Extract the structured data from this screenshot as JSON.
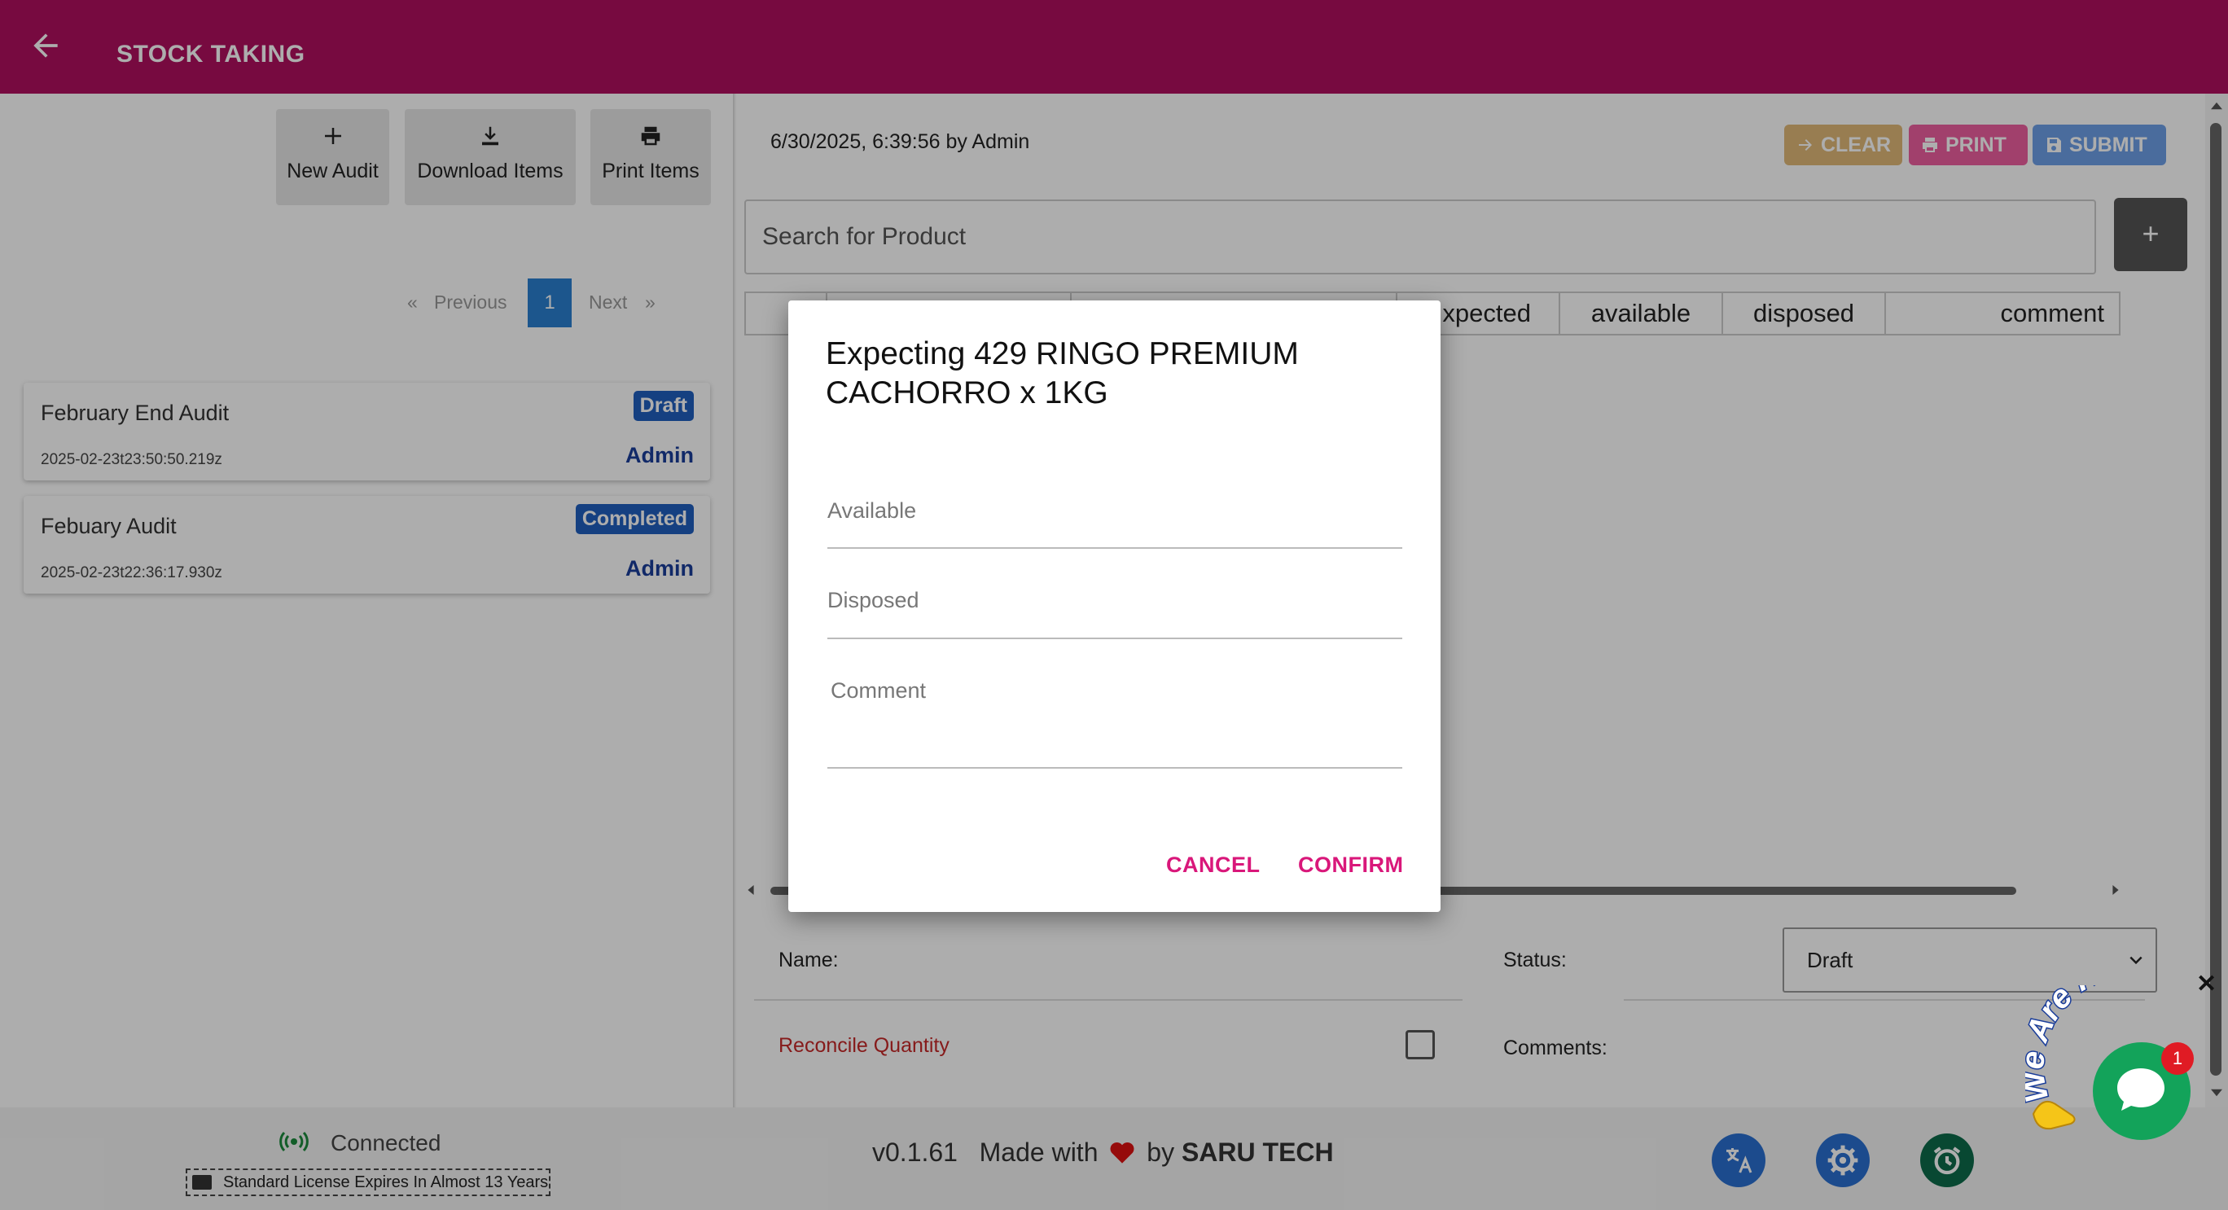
{
  "header": {
    "title": "STOCK TAKING"
  },
  "toolbar": {
    "new_audit": "New Audit",
    "download_items": "Download Items",
    "print_items": "Print Items"
  },
  "pager": {
    "previous": "Previous",
    "next": "Next",
    "current": "1",
    "prev_arrow": "«",
    "next_arrow": "»"
  },
  "audits": [
    {
      "name": "February End Audit",
      "status": "Draft",
      "timestamp": "2025-02-23t23:50:50.219z",
      "user": "Admin"
    },
    {
      "name": "Febuary Audit",
      "status": "Completed",
      "timestamp": "2025-02-23t22:36:17.930z",
      "user": "Admin"
    }
  ],
  "detail": {
    "date": "6/30/2025, 6:39:56 by Admin",
    "actions": {
      "clear": "CLEAR",
      "print": "PRINT",
      "submit": "SUBMIT"
    },
    "search_placeholder": "Search for Product",
    "add": "+",
    "columns": [
      "xpected",
      "available",
      "disposed",
      "comment"
    ],
    "name_label": "Name:",
    "status_label": "Status:",
    "status_value": "Draft",
    "reconcile_label": "Reconcile Quantity",
    "comments_label": "Comments:"
  },
  "dialog": {
    "title": "Expecting 429 RINGO PREMIUM CACHORRO x 1KG",
    "available": "Available",
    "disposed": "Disposed",
    "comment": "Comment",
    "cancel": "CANCEL",
    "confirm": "CONFIRM"
  },
  "footer": {
    "connection": "Connected",
    "license": "Standard License Expires In Almost 13 Years",
    "version": "v0.1.61",
    "made_with": "Made with",
    "by": "by",
    "company": "SARU TECH"
  },
  "chat": {
    "tagline": "We Are Here!",
    "unread": "1",
    "close": "✕"
  },
  "colors": {
    "header": "#b0105f",
    "accent": "#d9177a",
    "chat": "#13a35a"
  }
}
